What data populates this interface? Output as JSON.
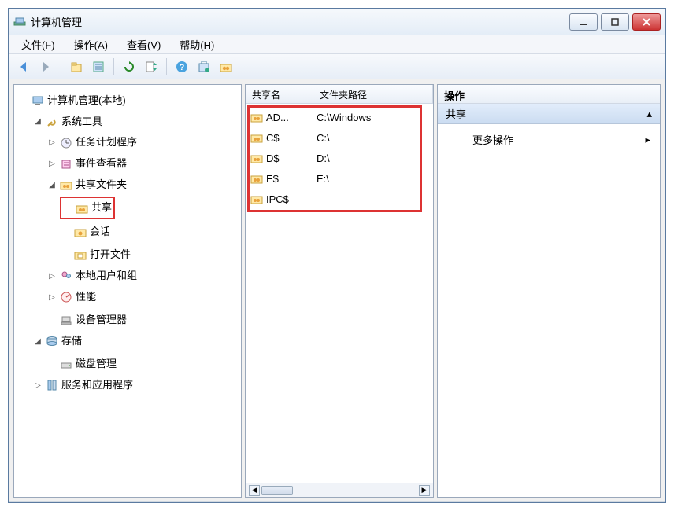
{
  "window": {
    "title": "计算机管理"
  },
  "menu": {
    "file": "文件(F)",
    "action": "操作(A)",
    "view": "查看(V)",
    "help": "帮助(H)"
  },
  "tree": {
    "root": "计算机管理(本地)",
    "system_tools": "系统工具",
    "task_scheduler": "任务计划程序",
    "event_viewer": "事件查看器",
    "shared_folders": "共享文件夹",
    "shares": "共享",
    "sessions": "会话",
    "open_files": "打开文件",
    "local_users": "本地用户和组",
    "performance": "性能",
    "device_manager": "设备管理器",
    "storage": "存储",
    "disk_management": "磁盘管理",
    "services_apps": "服务和应用程序"
  },
  "list": {
    "col_name": "共享名",
    "col_path": "文件夹路径",
    "rows": [
      {
        "name": "AD...",
        "path": "C:\\Windows"
      },
      {
        "name": "C$",
        "path": "C:\\"
      },
      {
        "name": "D$",
        "path": "D:\\"
      },
      {
        "name": "E$",
        "path": "E:\\"
      },
      {
        "name": "IPC$",
        "path": ""
      }
    ]
  },
  "actions": {
    "header": "操作",
    "section": "共享",
    "more": "更多操作"
  }
}
